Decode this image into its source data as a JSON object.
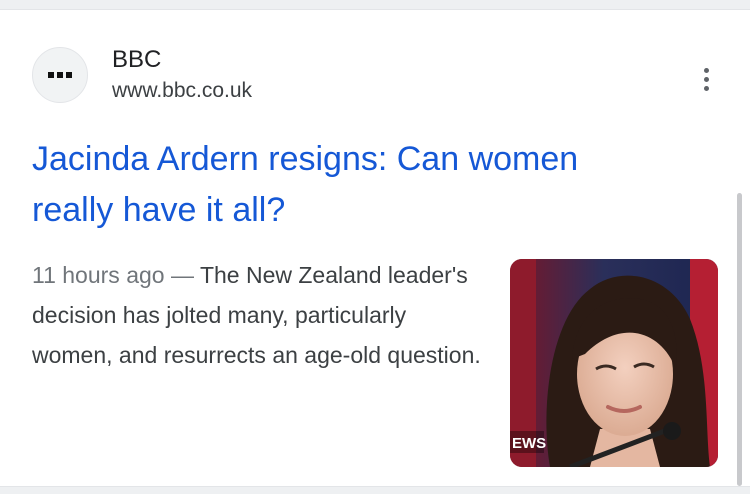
{
  "result": {
    "source": {
      "name": "BBC",
      "url": "www.bbc.co.uk",
      "favicon": "bbc-logo-icon"
    },
    "headline": {
      "line1": "Jacinda Ardern resigns: Can women",
      "line2": "really have it all?"
    },
    "snippet": {
      "time": "11 hours ago",
      "separator": " — ",
      "text": "The New Zealand leader's decision has jolted many, particularly women, and resurrects an age-old question."
    },
    "thumbnail": {
      "caption": "EWS"
    },
    "menu_icon": "more-vert-icon"
  },
  "colors": {
    "link": "#1558d6",
    "text": "#3c4043",
    "muted": "#70757a",
    "separator": "#eef0f2"
  }
}
